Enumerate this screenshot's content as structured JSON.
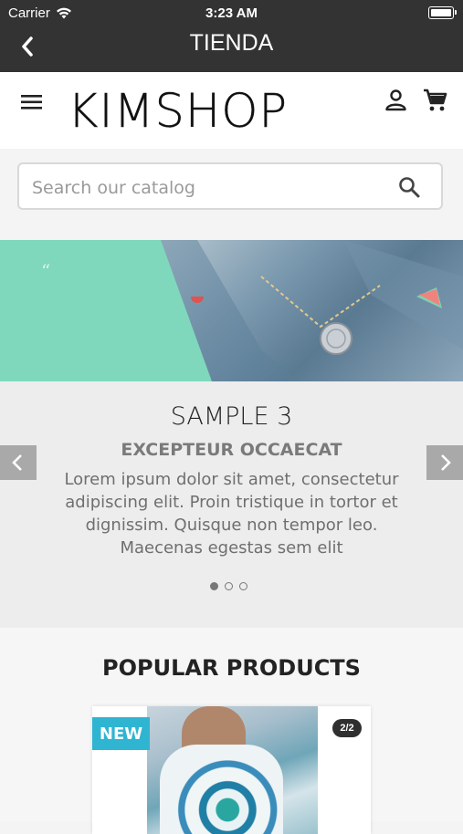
{
  "status_bar": {
    "carrier": "Carrier",
    "time": "3:23 AM"
  },
  "nav": {
    "title": "TIENDA",
    "back_icon": "chevron-left-icon"
  },
  "header": {
    "logo": "KIMSHOP",
    "menu_icon": "hamburger-icon",
    "user_icon": "user-icon",
    "cart_icon": "cart-icon"
  },
  "search": {
    "placeholder": "Search our catalog",
    "value": "",
    "icon": "search-icon"
  },
  "slider": {
    "title": "SAMPLE 3",
    "subtitle": "EXCEPTEUR OCCAECAT",
    "text": "Lorem ipsum dolor sit amet, consectetur adipiscing elit. Proin tristique in tortor et dignissim. Quisque non tempor leo. Maecenas egestas sem elit",
    "quote_mark": "“",
    "active_index": 0,
    "slide_count": 3
  },
  "popular": {
    "title": "POPULAR PRODUCTS",
    "product": {
      "badge": "NEW",
      "image_count": "2/2"
    }
  },
  "colors": {
    "topbar": "#333333",
    "accent": "#2fb5d2",
    "mint": "#7fd8bb"
  }
}
